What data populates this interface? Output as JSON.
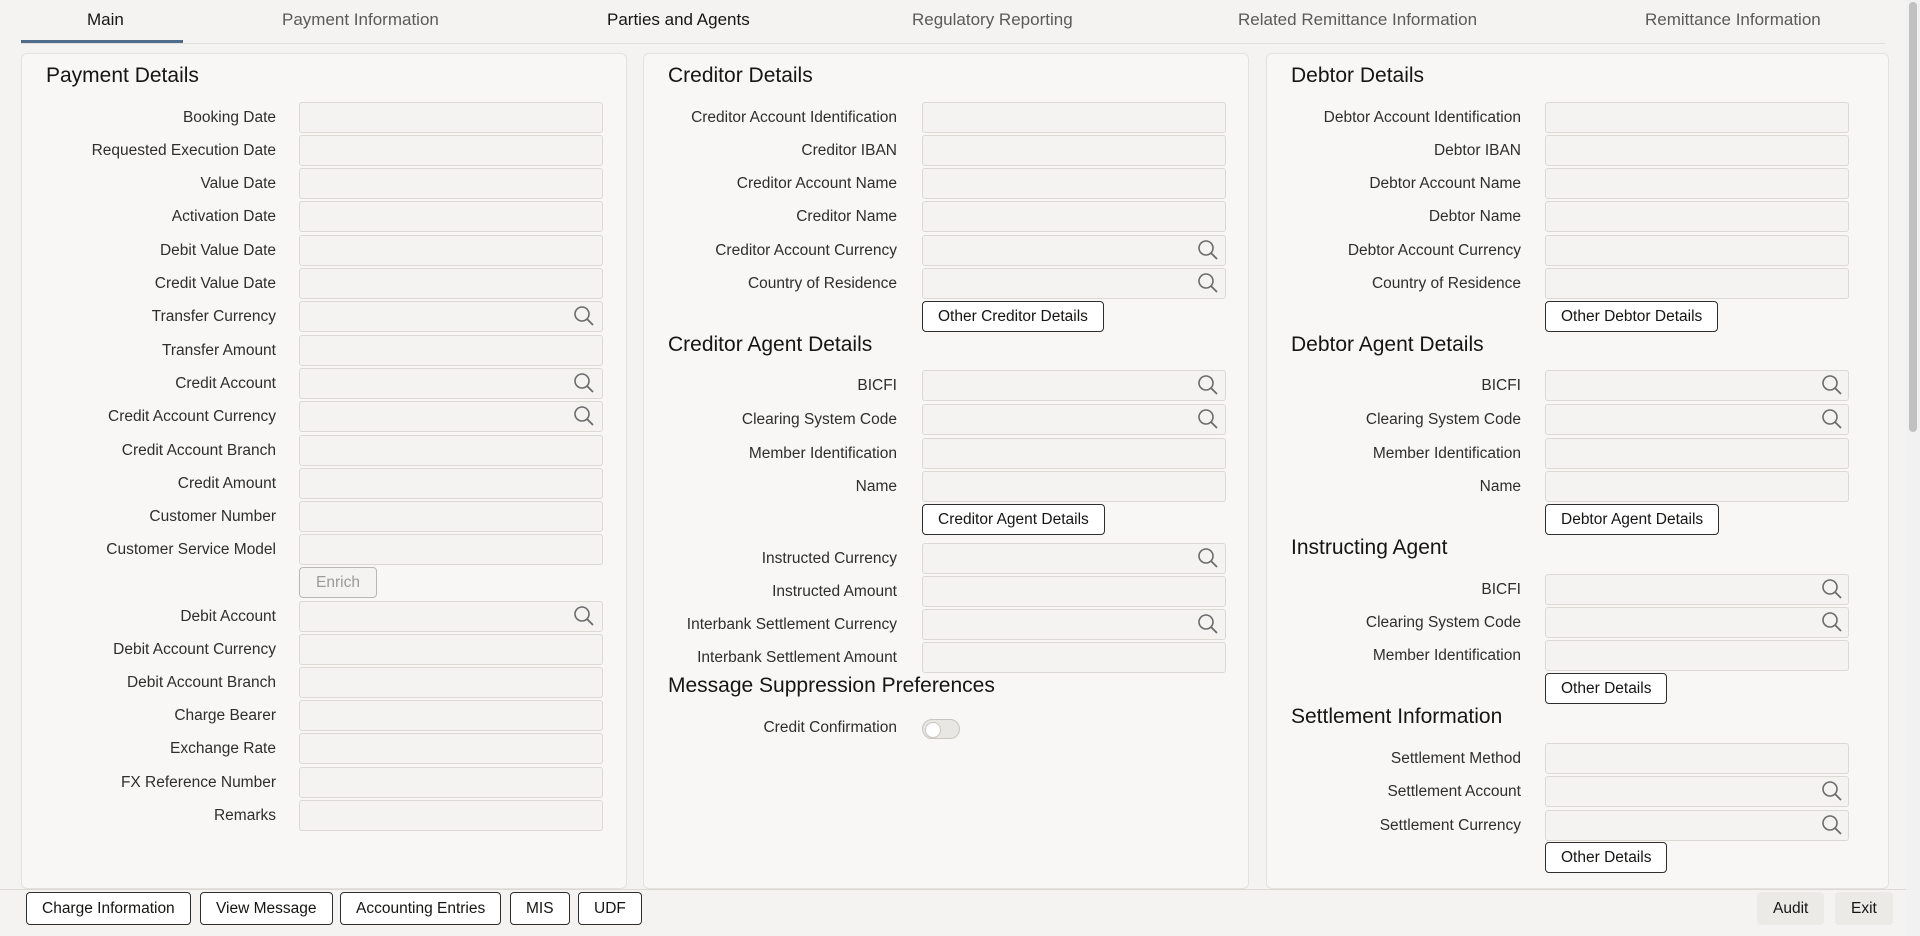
{
  "tabs": [
    {
      "label": "Main",
      "active": true
    },
    {
      "label": "Payment Information"
    },
    {
      "label": "Parties and Agents"
    },
    {
      "label": "Regulatory Reporting"
    },
    {
      "label": "Related Remittance Information"
    },
    {
      "label": "Remittance Information"
    }
  ],
  "payment": {
    "title": "Payment Details",
    "booking_date": "Booking Date",
    "requested_execution_date": "Requested Execution Date",
    "value_date": "Value Date",
    "activation_date": "Activation Date",
    "debit_value_date": "Debit Value Date",
    "credit_value_date": "Credit Value Date",
    "transfer_currency": "Transfer Currency",
    "transfer_amount": "Transfer Amount",
    "credit_account": "Credit Account",
    "credit_account_currency": "Credit Account Currency",
    "credit_account_branch": "Credit Account Branch",
    "credit_amount": "Credit Amount",
    "customer_number": "Customer Number",
    "customer_service_model": "Customer Service Model",
    "enrich_button": "Enrich",
    "debit_account": "Debit Account",
    "debit_account_currency": "Debit Account Currency",
    "debit_account_branch": "Debit Account Branch",
    "charge_bearer": "Charge Bearer",
    "exchange_rate": "Exchange Rate",
    "fx_reference_number": "FX Reference Number",
    "remarks": "Remarks"
  },
  "creditor": {
    "title": "Creditor Details",
    "account_identification": "Creditor Account Identification",
    "iban": "Creditor IBAN",
    "account_name": "Creditor Account Name",
    "name": "Creditor Name",
    "account_currency": "Creditor Account Currency",
    "country_of_residence": "Country of Residence",
    "other_button": "Other Creditor Details",
    "agent_title": "Creditor Agent Details",
    "bicfi": "BICFI",
    "clearing_system_code": "Clearing System Code",
    "member_identification": "Member Identification",
    "agent_name": "Name",
    "agent_button": "Creditor Agent Details",
    "instructed_currency": "Instructed Currency",
    "instructed_amount": "Instructed Amount",
    "interbank_settlement_currency": "Interbank Settlement Currency",
    "interbank_settlement_amount": "Interbank Settlement Amount",
    "suppression_title": "Message Suppression Preferences",
    "credit_confirmation": "Credit Confirmation",
    "credit_confirmation_on": false
  },
  "debtor": {
    "title": "Debtor Details",
    "account_identification": "Debtor Account Identification",
    "iban": "Debtor IBAN",
    "account_name": "Debtor Account Name",
    "name": "Debtor Name",
    "account_currency": "Debtor Account Currency",
    "country_of_residence": "Country of Residence",
    "other_button": "Other Debtor Details",
    "agent_title": "Debtor Agent Details",
    "bicfi": "BICFI",
    "clearing_system_code": "Clearing System Code",
    "member_identification": "Member Identification",
    "agent_name": "Name",
    "agent_button": "Debtor Agent Details",
    "instructing_title": "Instructing Agent",
    "instructing_bicfi": "BICFI",
    "instructing_clearing_system_code": "Clearing System Code",
    "instructing_member_identification": "Member Identification",
    "instructing_other_button": "Other Details",
    "settlement_title": "Settlement Information",
    "settlement_method": "Settlement Method",
    "settlement_account": "Settlement Account",
    "settlement_currency": "Settlement Currency",
    "settlement_other_button": "Other Details"
  },
  "footer": {
    "charge_information": "Charge Information",
    "view_message": "View Message",
    "accounting_entries": "Accounting Entries",
    "mis": "MIS",
    "udf": "UDF",
    "audit": "Audit",
    "exit": "Exit"
  }
}
